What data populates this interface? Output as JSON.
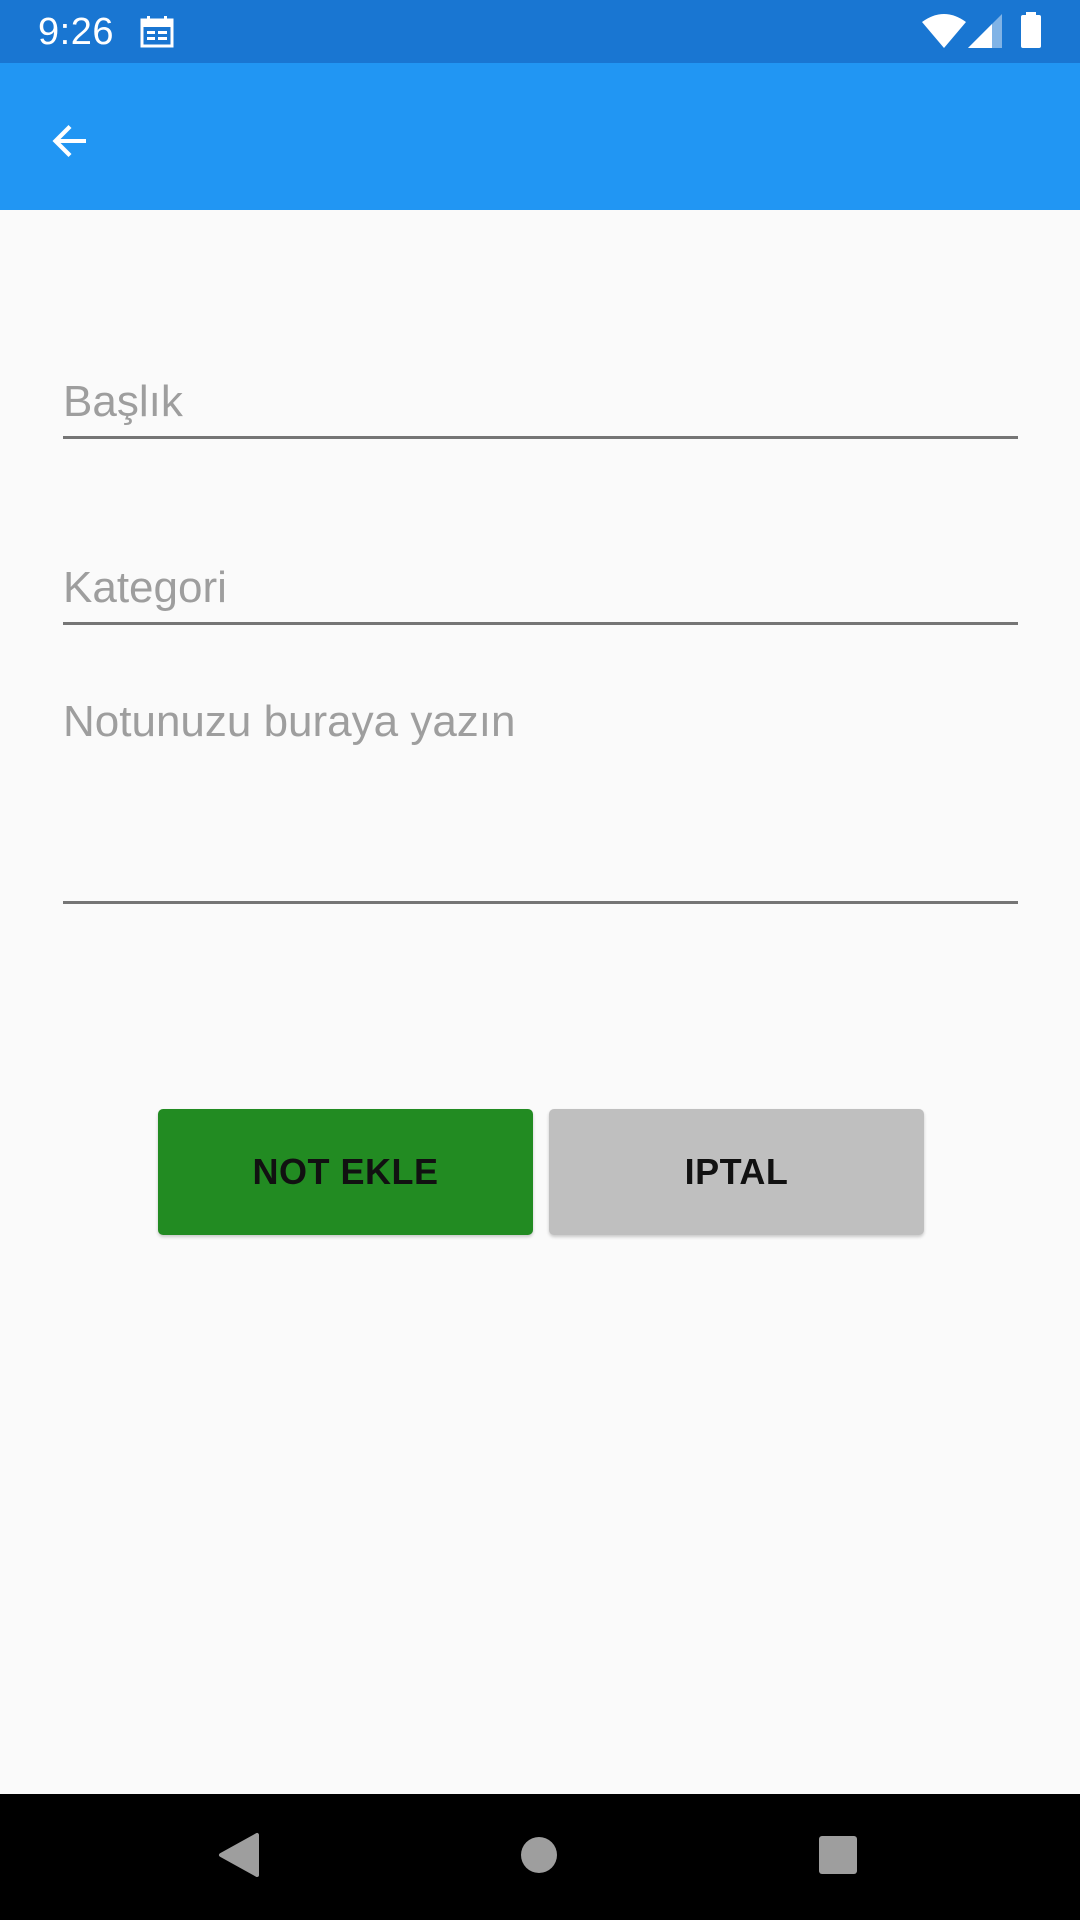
{
  "status_bar": {
    "time": "9:26",
    "icons": [
      "calendar-icon",
      "wifi-icon",
      "signal-icon",
      "battery-icon"
    ],
    "background_color": "#1976d2"
  },
  "app_bar": {
    "back_icon": "arrow-back-icon",
    "background_color": "#2196f3"
  },
  "form": {
    "title_placeholder": "Başlık",
    "title_value": "",
    "category_placeholder": "Kategori",
    "category_value": "",
    "note_placeholder": "Notunuzu buraya yazın",
    "note_value": ""
  },
  "buttons": {
    "add_label": "NOT EKLE",
    "add_color": "#228b22",
    "cancel_label": "IPTAL",
    "cancel_color": "#bfbfbf"
  },
  "nav_bar": {
    "icons": [
      "nav-back-icon",
      "nav-home-icon",
      "nav-recents-icon"
    ]
  }
}
